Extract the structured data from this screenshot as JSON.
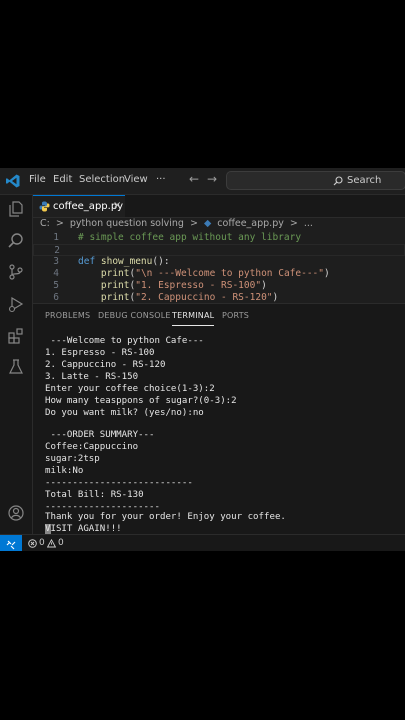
{
  "menu": {
    "file": "File",
    "edit": "Edit",
    "selection": "Selection",
    "view": "View",
    "more": "···"
  },
  "search": {
    "label": "Search"
  },
  "tab": {
    "label": "coffee_app.py",
    "close": "×"
  },
  "breadcrumb": [
    "C:",
    ">",
    "python question solving",
    ">",
    "coffee_app.py",
    ">",
    "..."
  ],
  "editor": {
    "lines": [
      {
        "num": "1",
        "segments": [
          {
            "t": "# simple coffee app without any library",
            "c": "c-com"
          }
        ]
      },
      {
        "num": "2",
        "segments": []
      },
      {
        "num": "3",
        "segments": [
          {
            "t": "def ",
            "c": "c-kw"
          },
          {
            "t": "show_menu",
            "c": "c-fn"
          },
          {
            "t": "():",
            "c": "c-txt"
          }
        ]
      },
      {
        "num": "4",
        "segments": [
          {
            "t": "    ",
            "c": "c-txt"
          },
          {
            "t": "print",
            "c": "c-fn"
          },
          {
            "t": "(",
            "c": "c-txt"
          },
          {
            "t": "\"\\n ---Welcome to python Cafe---\"",
            "c": "c-str"
          },
          {
            "t": ")",
            "c": "c-txt"
          }
        ]
      },
      {
        "num": "5",
        "segments": [
          {
            "t": "    ",
            "c": "c-txt"
          },
          {
            "t": "print",
            "c": "c-fn"
          },
          {
            "t": "(",
            "c": "c-txt"
          },
          {
            "t": "\"1. Espresso - RS-100\"",
            "c": "c-str"
          },
          {
            "t": ")",
            "c": "c-txt"
          }
        ]
      },
      {
        "num": "6",
        "segments": [
          {
            "t": "    ",
            "c": "c-txt"
          },
          {
            "t": "print",
            "c": "c-fn"
          },
          {
            "t": "(",
            "c": "c-txt"
          },
          {
            "t": "\"2. Cappuccino - RS-120\"",
            "c": "c-str"
          },
          {
            "t": ")",
            "c": "c-txt"
          }
        ]
      }
    ]
  },
  "panel": {
    "tabs": [
      "PROBLEMS",
      "DEBUG CONSOLE",
      "TERMINAL",
      "PORTS"
    ],
    "active": "TERMINAL"
  },
  "terminal": {
    "lines": [
      " ---Welcome to python Cafe---",
      "1. Espresso - RS-100",
      "2. Cappuccino - RS-120",
      "3. Latte - RS-150",
      "Enter your coffee choice(1-3):2",
      "How many teasppons of sugar?(0-3):2",
      "Do you want milk? (yes/no):no",
      "",
      " ---ORDER SUMMARY---",
      "Coffee:Cappuccino",
      "sugar:2tsp",
      "milk:No",
      "---------------------------",
      "Total Bill: RS-130",
      "---------------------",
      "Thank you for your order! Enjoy your coffee.",
      "VISIT AGAIN!!!"
    ]
  },
  "status": {
    "errors": "0",
    "warnings": "0"
  },
  "colors": {
    "accent": "#0078d4",
    "background": "#1e1e1e",
    "panel": "#181818"
  },
  "icons": [
    "vscode-logo-icon",
    "explorer-icon",
    "search-icon",
    "source-control-icon",
    "run-debug-icon",
    "extensions-icon",
    "testing-icon",
    "account-icon",
    "settings-gear-icon",
    "python-file-icon",
    "remote-icon",
    "error-icon",
    "warning-icon"
  ]
}
